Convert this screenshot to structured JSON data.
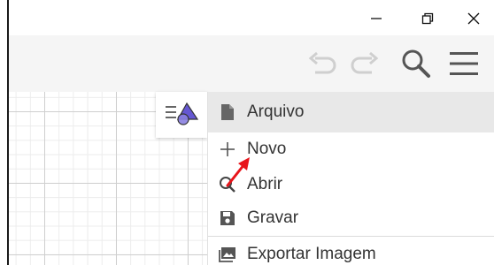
{
  "window": {
    "minimize_icon": "minimize-icon",
    "restore_icon": "restore-icon",
    "close_icon": "close-icon"
  },
  "toolbar": {
    "undo_icon": "undo-icon",
    "redo_icon": "redo-icon",
    "search_icon": "search-icon",
    "menu_icon": "hamburger-menu-icon"
  },
  "style_bar": {
    "icon": "graphics-style-icon"
  },
  "menu": {
    "header": {
      "icon": "file-icon",
      "label": "Arquivo"
    },
    "items": [
      {
        "icon": "plus-icon",
        "label": "Novo"
      },
      {
        "icon": "search-icon",
        "label": "Abrir"
      },
      {
        "icon": "save-icon",
        "label": "Gravar"
      },
      {
        "icon": "image-icon",
        "label": "Exportar Imagem"
      }
    ]
  },
  "colors": {
    "annotation_arrow": "#e8141a",
    "toolbar_bg": "#f5f5f5",
    "menu_header_bg": "#e8e8e8",
    "shape_accent": "#6557d2"
  }
}
